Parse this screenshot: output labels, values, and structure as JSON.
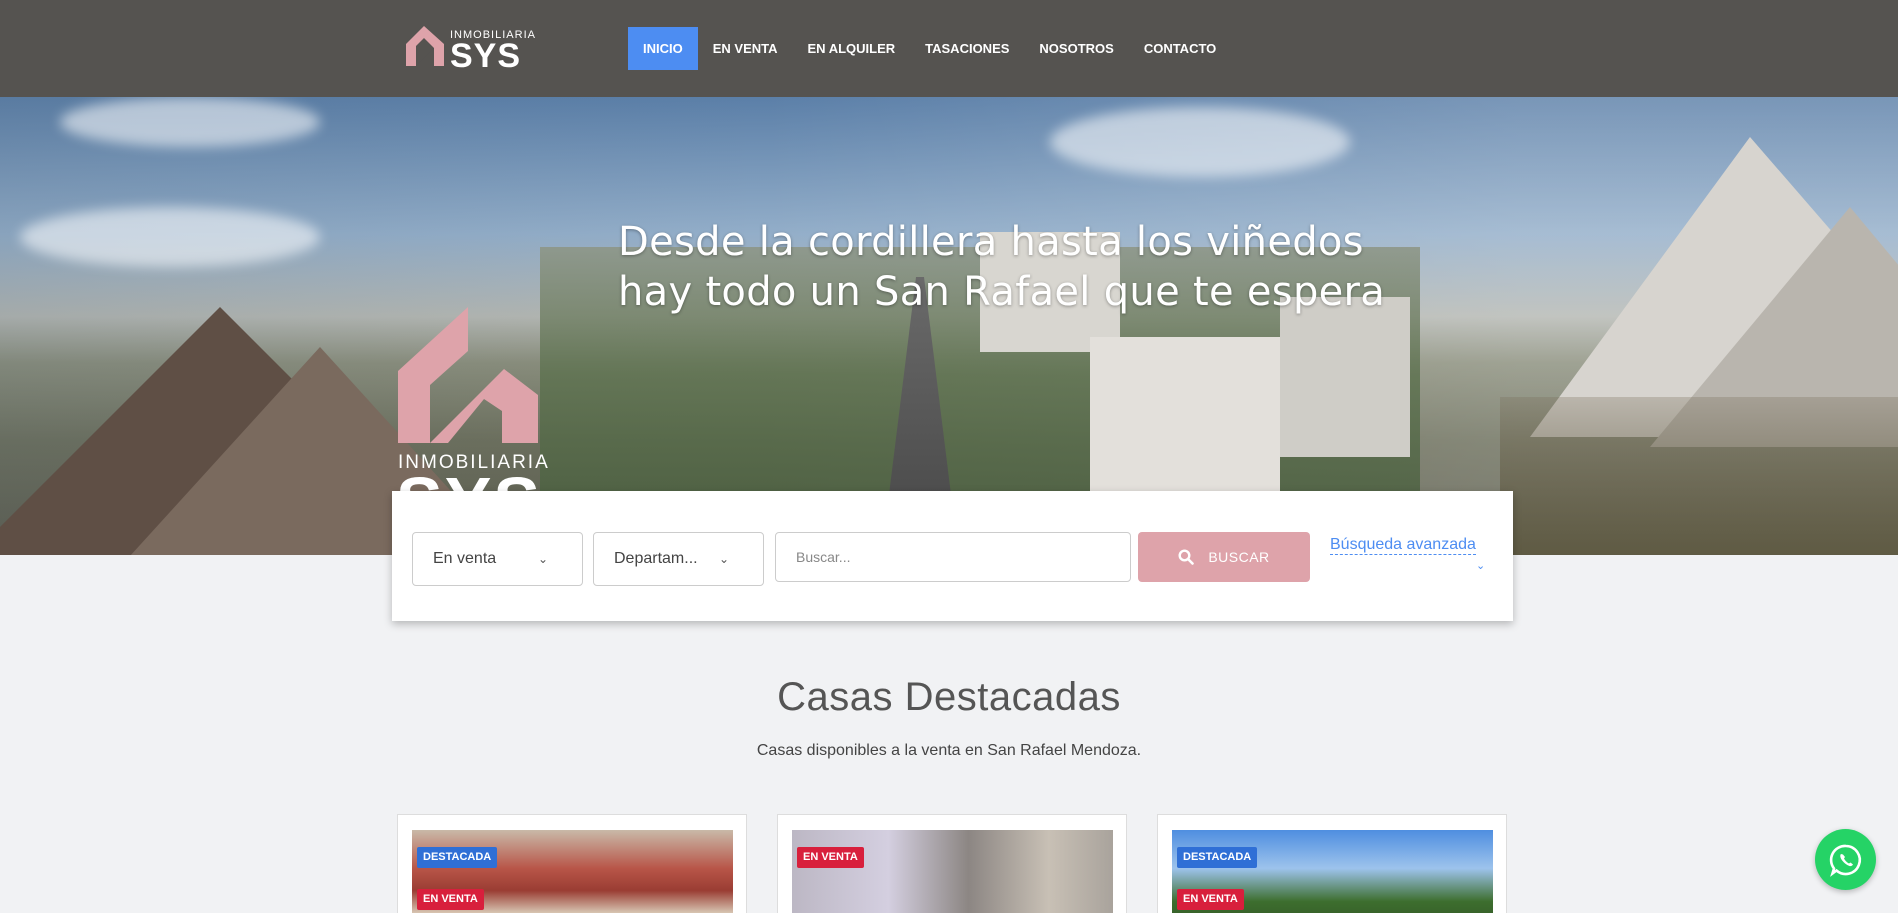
{
  "header": {
    "logo": {
      "small": "INMOBILIARIA",
      "big": "SYS"
    },
    "nav": [
      {
        "label": "INICIO",
        "active": true
      },
      {
        "label": "EN VENTA",
        "active": false
      },
      {
        "label": "EN ALQUILER",
        "active": false
      },
      {
        "label": "TASACIONES",
        "active": false
      },
      {
        "label": "NOSOTROS",
        "active": false
      },
      {
        "label": "CONTACTO",
        "active": false
      }
    ]
  },
  "hero": {
    "title_line1": "Desde la cordillera hasta los viñedos",
    "title_line2": "hay todo un San Rafael que te espera",
    "logo_small": "INMOBILIARIA",
    "logo_big": "SYS"
  },
  "search": {
    "operation": "En venta",
    "location": "Departam...",
    "placeholder": "Buscar...",
    "button_label": "BUSCAR",
    "advanced_label": "Búsqueda avanzada"
  },
  "featured": {
    "title": "Casas Destacadas",
    "subtitle": "Casas disponibles a la venta en San Rafael Mendoza.",
    "cards": [
      {
        "badges": [
          "DESTACADA",
          "EN VENTA"
        ]
      },
      {
        "badges": [
          "EN VENTA"
        ]
      },
      {
        "badges": [
          "DESTACADA",
          "EN VENTA"
        ]
      }
    ]
  },
  "colors": {
    "header_bg": "#555350",
    "accent_blue": "#4d8df2",
    "brand_pink": "#dea3aa",
    "badge_destacada": "#2f6fd6",
    "badge_venta": "#d81f3c",
    "whatsapp": "#25d366"
  },
  "icons": [
    "search-icon",
    "chevron-down-icon",
    "whatsapp-icon"
  ]
}
